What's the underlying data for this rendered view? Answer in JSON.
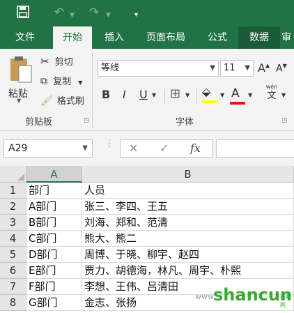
{
  "quick_access": {
    "save_icon": "save-icon",
    "undo_icon": "undo-icon",
    "redo_icon": "redo-icon",
    "customize_icon": "customize-qat-icon"
  },
  "tabs": [
    {
      "label": "文件"
    },
    {
      "label": "开始"
    },
    {
      "label": "插入"
    },
    {
      "label": "页面布局"
    },
    {
      "label": "公式"
    },
    {
      "label": "数据"
    },
    {
      "label": "审"
    }
  ],
  "ribbon": {
    "clipboard": {
      "paste_label": "粘贴",
      "cut_label": "剪切",
      "copy_label": "复制",
      "format_painter_label": "格式刷",
      "group_label": "剪贴板"
    },
    "font": {
      "font_name": "等线",
      "font_size": "11",
      "bold": "B",
      "italic": "I",
      "underline": "U",
      "font_color_letter": "A",
      "font_color": "#e81123",
      "highlight_color": "#ffff00",
      "phonetic_label": "wén",
      "phonetic_char": "文",
      "group_label": "字体"
    }
  },
  "formula_bar": {
    "name_box": "A29",
    "cancel_glyph": "✕",
    "enter_glyph": "✓",
    "fx_label": "fx",
    "formula": ""
  },
  "sheet": {
    "columns": [
      "A",
      "B"
    ],
    "selected_column": "A",
    "rows": [
      {
        "num": "1",
        "a": "部门",
        "b": "人员"
      },
      {
        "num": "2",
        "a": "A部门",
        "b": "张三、李四、王五"
      },
      {
        "num": "3",
        "a": "B部门",
        "b": "刘海、郑和、范清"
      },
      {
        "num": "4",
        "a": "C部门",
        "b": "熊大、熊二"
      },
      {
        "num": "5",
        "a": "D部门",
        "b": "周博、于晓、柳宇、赵四"
      },
      {
        "num": "6",
        "a": "E部门",
        "b": "贾力、胡德海，林凡、周宇、朴熙"
      },
      {
        "num": "7",
        "a": "F部门",
        "b": "李想、王伟、吕清田"
      },
      {
        "num": "8",
        "a": "G部门",
        "b": "金志、张扬"
      }
    ]
  },
  "watermark": {
    "lead": "www.",
    "brand": "shancun",
    "sub": "山村网"
  }
}
